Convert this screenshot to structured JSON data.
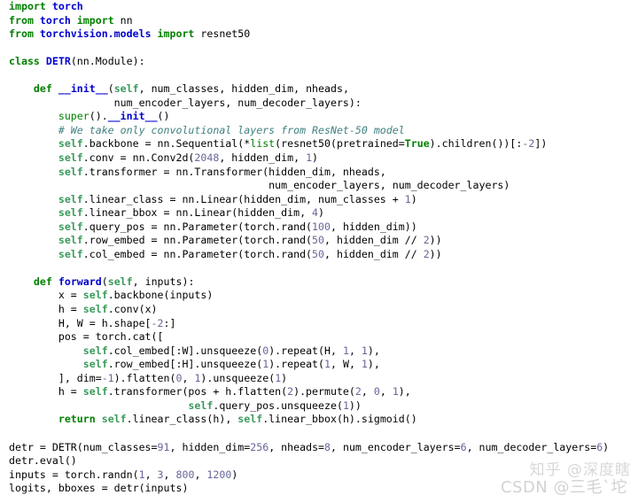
{
  "editor": {
    "language": "python",
    "background_color": "#ffffff",
    "foreground_color": "#000000",
    "colors": {
      "keyword": "#008000",
      "self": "#3a9a5c",
      "name": "#0000cf",
      "number": "#666699",
      "comment": "#408080",
      "constant": "#008000",
      "plain": "#000000"
    }
  },
  "code": {
    "full_text": "import torch\nfrom torch import nn\nfrom torchvision.models import resnet50\n\nclass DETR(nn.Module):\n\n    def __init__(self, num_classes, hidden_dim, nheads,\n                 num_encoder_layers, num_decoder_layers):\n        super().__init__()\n        # We take only convolutional layers from ResNet-50 model\n        self.backbone = nn.Sequential(*list(resnet50(pretrained=True).children())[:-2])\n        self.conv = nn.Conv2d(2048, hidden_dim, 1)\n        self.transformer = nn.Transformer(hidden_dim, nheads,\n                                          num_encoder_layers, num_decoder_layers)\n        self.linear_class = nn.Linear(hidden_dim, num_classes + 1)\n        self.linear_bbox = nn.Linear(hidden_dim, 4)\n        self.query_pos = nn.Parameter(torch.rand(100, hidden_dim))\n        self.row_embed = nn.Parameter(torch.rand(50, hidden_dim // 2))\n        self.col_embed = nn.Parameter(torch.rand(50, hidden_dim // 2))\n\n    def forward(self, inputs):\n        x = self.backbone(inputs)\n        h = self.conv(x)\n        H, W = h.shape[-2:]\n        pos = torch.cat([\n            self.col_embed[:W].unsqueeze(0).repeat(H, 1, 1),\n            self.row_embed[:H].unsqueeze(1).repeat(1, W, 1),\n        ], dim=-1).flatten(0, 1).unsqueeze(1)\n        h = self.transformer(pos + h.flatten(2).permute(2, 0, 1),\n                             self.query_pos.unsqueeze(1))\n        return self.linear_class(h), self.linear_bbox(h).sigmoid()\n\ndetr = DETR(num_classes=91, hidden_dim=256, nheads=8, num_encoder_layers=6, num_decoder_layers=6)\ndetr.eval()\ninputs = torch.randn(1, 3, 800, 1200)\nlogits, bboxes = detr(inputs)",
    "lines": [
      {
        "n": 1,
        "tokens": [
          {
            "t": "import",
            "c": "kw"
          },
          {
            "t": " ",
            "c": "plain"
          },
          {
            "t": "torch",
            "c": "mod"
          }
        ]
      },
      {
        "n": 2,
        "tokens": [
          {
            "t": "from",
            "c": "kw"
          },
          {
            "t": " ",
            "c": "plain"
          },
          {
            "t": "torch",
            "c": "mod"
          },
          {
            "t": " ",
            "c": "plain"
          },
          {
            "t": "import",
            "c": "kw"
          },
          {
            "t": " ",
            "c": "plain"
          },
          {
            "t": "nn",
            "c": "plain"
          }
        ]
      },
      {
        "n": 3,
        "tokens": [
          {
            "t": "from",
            "c": "kw"
          },
          {
            "t": " ",
            "c": "plain"
          },
          {
            "t": "torchvision.models",
            "c": "mod"
          },
          {
            "t": " ",
            "c": "plain"
          },
          {
            "t": "import",
            "c": "kw"
          },
          {
            "t": " ",
            "c": "plain"
          },
          {
            "t": "resnet50",
            "c": "plain"
          }
        ]
      },
      {
        "n": 4,
        "tokens": []
      },
      {
        "n": 5,
        "tokens": [
          {
            "t": "class",
            "c": "kw"
          },
          {
            "t": " ",
            "c": "plain"
          },
          {
            "t": "DETR",
            "c": "name"
          },
          {
            "t": "(nn.Module):",
            "c": "plain"
          }
        ]
      },
      {
        "n": 6,
        "tokens": []
      },
      {
        "n": 7,
        "tokens": [
          {
            "t": "    ",
            "c": "plain"
          },
          {
            "t": "def",
            "c": "kw"
          },
          {
            "t": " ",
            "c": "plain"
          },
          {
            "t": "__init__",
            "c": "name"
          },
          {
            "t": "(",
            "c": "plain"
          },
          {
            "t": "self",
            "c": "self"
          },
          {
            "t": ", num_classes, hidden_dim, nheads,",
            "c": "plain"
          }
        ]
      },
      {
        "n": 8,
        "tokens": [
          {
            "t": "                 num_encoder_layers, num_decoder_layers):",
            "c": "plain"
          }
        ]
      },
      {
        "n": 9,
        "tokens": [
          {
            "t": "        ",
            "c": "plain"
          },
          {
            "t": "super",
            "c": "builtin"
          },
          {
            "t": "().",
            "c": "plain"
          },
          {
            "t": "__init__",
            "c": "name"
          },
          {
            "t": "()",
            "c": "plain"
          }
        ]
      },
      {
        "n": 10,
        "tokens": [
          {
            "t": "        ",
            "c": "plain"
          },
          {
            "t": "# We take only convolutional layers from ResNet-50 model",
            "c": "com"
          }
        ]
      },
      {
        "n": 11,
        "tokens": [
          {
            "t": "        ",
            "c": "plain"
          },
          {
            "t": "self",
            "c": "self"
          },
          {
            "t": ".backbone = nn.Sequential(*",
            "c": "plain"
          },
          {
            "t": "list",
            "c": "builtin"
          },
          {
            "t": "(resnet50(pretrained=",
            "c": "plain"
          },
          {
            "t": "True",
            "c": "const"
          },
          {
            "t": ").children())[:",
            "c": "plain"
          },
          {
            "t": "-2",
            "c": "num"
          },
          {
            "t": "])",
            "c": "plain"
          }
        ]
      },
      {
        "n": 12,
        "tokens": [
          {
            "t": "        ",
            "c": "plain"
          },
          {
            "t": "self",
            "c": "self"
          },
          {
            "t": ".conv = nn.Conv2d(",
            "c": "plain"
          },
          {
            "t": "2048",
            "c": "num"
          },
          {
            "t": ", hidden_dim, ",
            "c": "plain"
          },
          {
            "t": "1",
            "c": "num"
          },
          {
            "t": ")",
            "c": "plain"
          }
        ]
      },
      {
        "n": 13,
        "tokens": [
          {
            "t": "        ",
            "c": "plain"
          },
          {
            "t": "self",
            "c": "self"
          },
          {
            "t": ".transformer = nn.Transformer(hidden_dim, nheads,",
            "c": "plain"
          }
        ]
      },
      {
        "n": 14,
        "tokens": [
          {
            "t": "                                          num_encoder_layers, num_decoder_layers)",
            "c": "plain"
          }
        ]
      },
      {
        "n": 15,
        "tokens": [
          {
            "t": "        ",
            "c": "plain"
          },
          {
            "t": "self",
            "c": "self"
          },
          {
            "t": ".linear_class = nn.Linear(hidden_dim, num_classes + ",
            "c": "plain"
          },
          {
            "t": "1",
            "c": "num"
          },
          {
            "t": ")",
            "c": "plain"
          }
        ]
      },
      {
        "n": 16,
        "tokens": [
          {
            "t": "        ",
            "c": "plain"
          },
          {
            "t": "self",
            "c": "self"
          },
          {
            "t": ".linear_bbox = nn.Linear(hidden_dim, ",
            "c": "plain"
          },
          {
            "t": "4",
            "c": "num"
          },
          {
            "t": ")",
            "c": "plain"
          }
        ]
      },
      {
        "n": 17,
        "tokens": [
          {
            "t": "        ",
            "c": "plain"
          },
          {
            "t": "self",
            "c": "self"
          },
          {
            "t": ".query_pos = nn.Parameter(torch.rand(",
            "c": "plain"
          },
          {
            "t": "100",
            "c": "num"
          },
          {
            "t": ", hidden_dim))",
            "c": "plain"
          }
        ]
      },
      {
        "n": 18,
        "tokens": [
          {
            "t": "        ",
            "c": "plain"
          },
          {
            "t": "self",
            "c": "self"
          },
          {
            "t": ".row_embed = nn.Parameter(torch.rand(",
            "c": "plain"
          },
          {
            "t": "50",
            "c": "num"
          },
          {
            "t": ", hidden_dim // ",
            "c": "plain"
          },
          {
            "t": "2",
            "c": "num"
          },
          {
            "t": "))",
            "c": "plain"
          }
        ]
      },
      {
        "n": 19,
        "tokens": [
          {
            "t": "        ",
            "c": "plain"
          },
          {
            "t": "self",
            "c": "self"
          },
          {
            "t": ".col_embed = nn.Parameter(torch.rand(",
            "c": "plain"
          },
          {
            "t": "50",
            "c": "num"
          },
          {
            "t": ", hidden_dim // ",
            "c": "plain"
          },
          {
            "t": "2",
            "c": "num"
          },
          {
            "t": "))",
            "c": "plain"
          }
        ]
      },
      {
        "n": 20,
        "tokens": []
      },
      {
        "n": 21,
        "tokens": [
          {
            "t": "    ",
            "c": "plain"
          },
          {
            "t": "def",
            "c": "kw"
          },
          {
            "t": " ",
            "c": "plain"
          },
          {
            "t": "forward",
            "c": "name"
          },
          {
            "t": "(",
            "c": "plain"
          },
          {
            "t": "self",
            "c": "self"
          },
          {
            "t": ", inputs):",
            "c": "plain"
          }
        ]
      },
      {
        "n": 22,
        "tokens": [
          {
            "t": "        x = ",
            "c": "plain"
          },
          {
            "t": "self",
            "c": "self"
          },
          {
            "t": ".backbone(inputs)",
            "c": "plain"
          }
        ]
      },
      {
        "n": 23,
        "tokens": [
          {
            "t": "        h = ",
            "c": "plain"
          },
          {
            "t": "self",
            "c": "self"
          },
          {
            "t": ".conv(x)",
            "c": "plain"
          }
        ]
      },
      {
        "n": 24,
        "tokens": [
          {
            "t": "        H, W = h.shape[",
            "c": "plain"
          },
          {
            "t": "-2",
            "c": "num"
          },
          {
            "t": ":]",
            "c": "plain"
          }
        ]
      },
      {
        "n": 25,
        "tokens": [
          {
            "t": "        pos = torch.cat([",
            "c": "plain"
          }
        ]
      },
      {
        "n": 26,
        "tokens": [
          {
            "t": "            ",
            "c": "plain"
          },
          {
            "t": "self",
            "c": "self"
          },
          {
            "t": ".col_embed[:W].unsqueeze(",
            "c": "plain"
          },
          {
            "t": "0",
            "c": "num"
          },
          {
            "t": ").repeat(H, ",
            "c": "plain"
          },
          {
            "t": "1",
            "c": "num"
          },
          {
            "t": ", ",
            "c": "plain"
          },
          {
            "t": "1",
            "c": "num"
          },
          {
            "t": "),",
            "c": "plain"
          }
        ]
      },
      {
        "n": 27,
        "tokens": [
          {
            "t": "            ",
            "c": "plain"
          },
          {
            "t": "self",
            "c": "self"
          },
          {
            "t": ".row_embed[:H].unsqueeze(",
            "c": "plain"
          },
          {
            "t": "1",
            "c": "num"
          },
          {
            "t": ").repeat(",
            "c": "plain"
          },
          {
            "t": "1",
            "c": "num"
          },
          {
            "t": ", W, ",
            "c": "plain"
          },
          {
            "t": "1",
            "c": "num"
          },
          {
            "t": "),",
            "c": "plain"
          }
        ]
      },
      {
        "n": 28,
        "tokens": [
          {
            "t": "        ], dim=",
            "c": "plain"
          },
          {
            "t": "-1",
            "c": "num"
          },
          {
            "t": ").flatten(",
            "c": "plain"
          },
          {
            "t": "0",
            "c": "num"
          },
          {
            "t": ", ",
            "c": "plain"
          },
          {
            "t": "1",
            "c": "num"
          },
          {
            "t": ").unsqueeze(",
            "c": "plain"
          },
          {
            "t": "1",
            "c": "num"
          },
          {
            "t": ")",
            "c": "plain"
          }
        ]
      },
      {
        "n": 29,
        "tokens": [
          {
            "t": "        h = ",
            "c": "plain"
          },
          {
            "t": "self",
            "c": "self"
          },
          {
            "t": ".transformer(pos + h.flatten(",
            "c": "plain"
          },
          {
            "t": "2",
            "c": "num"
          },
          {
            "t": ").permute(",
            "c": "plain"
          },
          {
            "t": "2",
            "c": "num"
          },
          {
            "t": ", ",
            "c": "plain"
          },
          {
            "t": "0",
            "c": "num"
          },
          {
            "t": ", ",
            "c": "plain"
          },
          {
            "t": "1",
            "c": "num"
          },
          {
            "t": "),",
            "c": "plain"
          }
        ]
      },
      {
        "n": 30,
        "tokens": [
          {
            "t": "                             ",
            "c": "plain"
          },
          {
            "t": "self",
            "c": "self"
          },
          {
            "t": ".query_pos.unsqueeze(",
            "c": "plain"
          },
          {
            "t": "1",
            "c": "num"
          },
          {
            "t": "))",
            "c": "plain"
          }
        ]
      },
      {
        "n": 31,
        "tokens": [
          {
            "t": "        ",
            "c": "plain"
          },
          {
            "t": "return",
            "c": "kw"
          },
          {
            "t": " ",
            "c": "plain"
          },
          {
            "t": "self",
            "c": "self"
          },
          {
            "t": ".linear_class(h), ",
            "c": "plain"
          },
          {
            "t": "self",
            "c": "self"
          },
          {
            "t": ".linear_bbox(h).sigmoid()",
            "c": "plain"
          }
        ]
      },
      {
        "n": 32,
        "tokens": []
      },
      {
        "n": 33,
        "tokens": [
          {
            "t": "detr = DETR(num_classes=",
            "c": "plain"
          },
          {
            "t": "91",
            "c": "num"
          },
          {
            "t": ", hidden_dim=",
            "c": "plain"
          },
          {
            "t": "256",
            "c": "num"
          },
          {
            "t": ", nheads=",
            "c": "plain"
          },
          {
            "t": "8",
            "c": "num"
          },
          {
            "t": ", num_encoder_layers=",
            "c": "plain"
          },
          {
            "t": "6",
            "c": "num"
          },
          {
            "t": ", num_decoder_layers=",
            "c": "plain"
          },
          {
            "t": "6",
            "c": "num"
          },
          {
            "t": ")",
            "c": "plain"
          }
        ]
      },
      {
        "n": 34,
        "tokens": [
          {
            "t": "detr.eval()",
            "c": "plain"
          }
        ]
      },
      {
        "n": 35,
        "tokens": [
          {
            "t": "inputs = torch.randn(",
            "c": "plain"
          },
          {
            "t": "1",
            "c": "num"
          },
          {
            "t": ", ",
            "c": "plain"
          },
          {
            "t": "3",
            "c": "num"
          },
          {
            "t": ", ",
            "c": "plain"
          },
          {
            "t": "800",
            "c": "num"
          },
          {
            "t": ", ",
            "c": "plain"
          },
          {
            "t": "1200",
            "c": "num"
          },
          {
            "t": ")",
            "c": "plain"
          }
        ]
      },
      {
        "n": 36,
        "tokens": [
          {
            "t": "logits, bboxes = detr(inputs)",
            "c": "plain"
          }
        ]
      }
    ]
  },
  "watermarks": {
    "zhihu": "知乎 @深度瞎",
    "csdn": "CSDN @三毛`坨"
  }
}
